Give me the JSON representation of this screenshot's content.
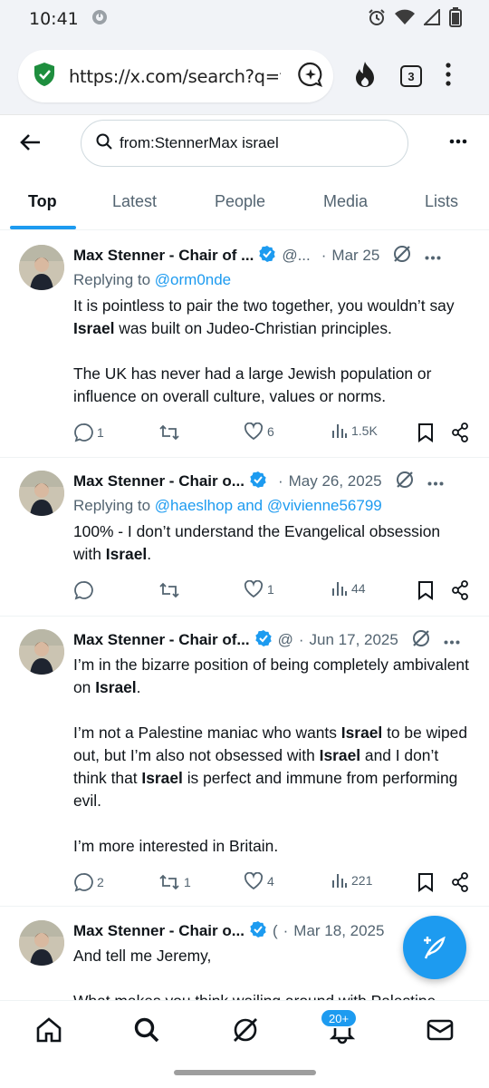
{
  "status_bar": {
    "time": "10:41"
  },
  "browser": {
    "url": "https://x.com/search?q=f",
    "tab_count": "3"
  },
  "header": {
    "search_query": "from:StennerMax israel"
  },
  "tabs": [
    {
      "label": "Top",
      "active": true
    },
    {
      "label": "Latest"
    },
    {
      "label": "People"
    },
    {
      "label": "Media"
    },
    {
      "label": "Lists"
    }
  ],
  "posts": [
    {
      "name": "Max Stenner - Chair of ...",
      "handle": "@...",
      "separator": "·",
      "date": "Mar 25",
      "reply_prefix": "Replying to ",
      "reply_to": "@orm0nde",
      "paragraphs": [
        [
          "It is pointless to pair the two together, you wouldn’t say ",
          "Israel",
          " was built on Judeo-Christian principles."
        ],
        [
          "The UK has never had a large Jewish population or influence on overall culture, values or norms."
        ]
      ],
      "replies": "1",
      "reposts": "",
      "likes": "6",
      "views": "1.5K"
    },
    {
      "name": "Max Stenner - Chair o...",
      "handle": "",
      "separator": "·",
      "date": "May 26, 2025",
      "reply_prefix": "Replying to ",
      "reply_to": "@haeslhop and @vivienne56799",
      "paragraphs": [
        [
          "100% - I don’t understand the Evangelical obsession with ",
          "Israel",
          "."
        ]
      ],
      "replies": "",
      "reposts": "",
      "likes": "1",
      "views": "44"
    },
    {
      "name": "Max Stenner - Chair of...",
      "handle": "@",
      "separator": "·",
      "date": "Jun 17, 2025",
      "paragraphs": [
        [
          "I’m in the bizarre position of being completely ambivalent on ",
          "Israel",
          "."
        ],
        [
          "I’m not a Palestine maniac who wants ",
          "Israel",
          " to be wiped  out, but I’m also not obsessed with ",
          "Israel",
          " and I don’t think that ",
          "Israel",
          " is perfect and immune from performing evil."
        ],
        [
          "I’m more interested in Britain."
        ]
      ],
      "replies": "2",
      "reposts": "1",
      "likes": "4",
      "views": "221"
    },
    {
      "name": "Max Stenner - Chair o...",
      "handle": "(",
      "separator": "·",
      "date": "Mar 18, 2025",
      "paragraphs": [
        [
          "And tell me Jeremy,"
        ],
        [
          "What makes you think wailing around with Palestine"
        ]
      ]
    }
  ],
  "bottom_nav": {
    "notifications_badge": "20+"
  },
  "colors": {
    "accent": "#1d9bf0",
    "text": "#0f1419",
    "secondary": "#536471"
  }
}
